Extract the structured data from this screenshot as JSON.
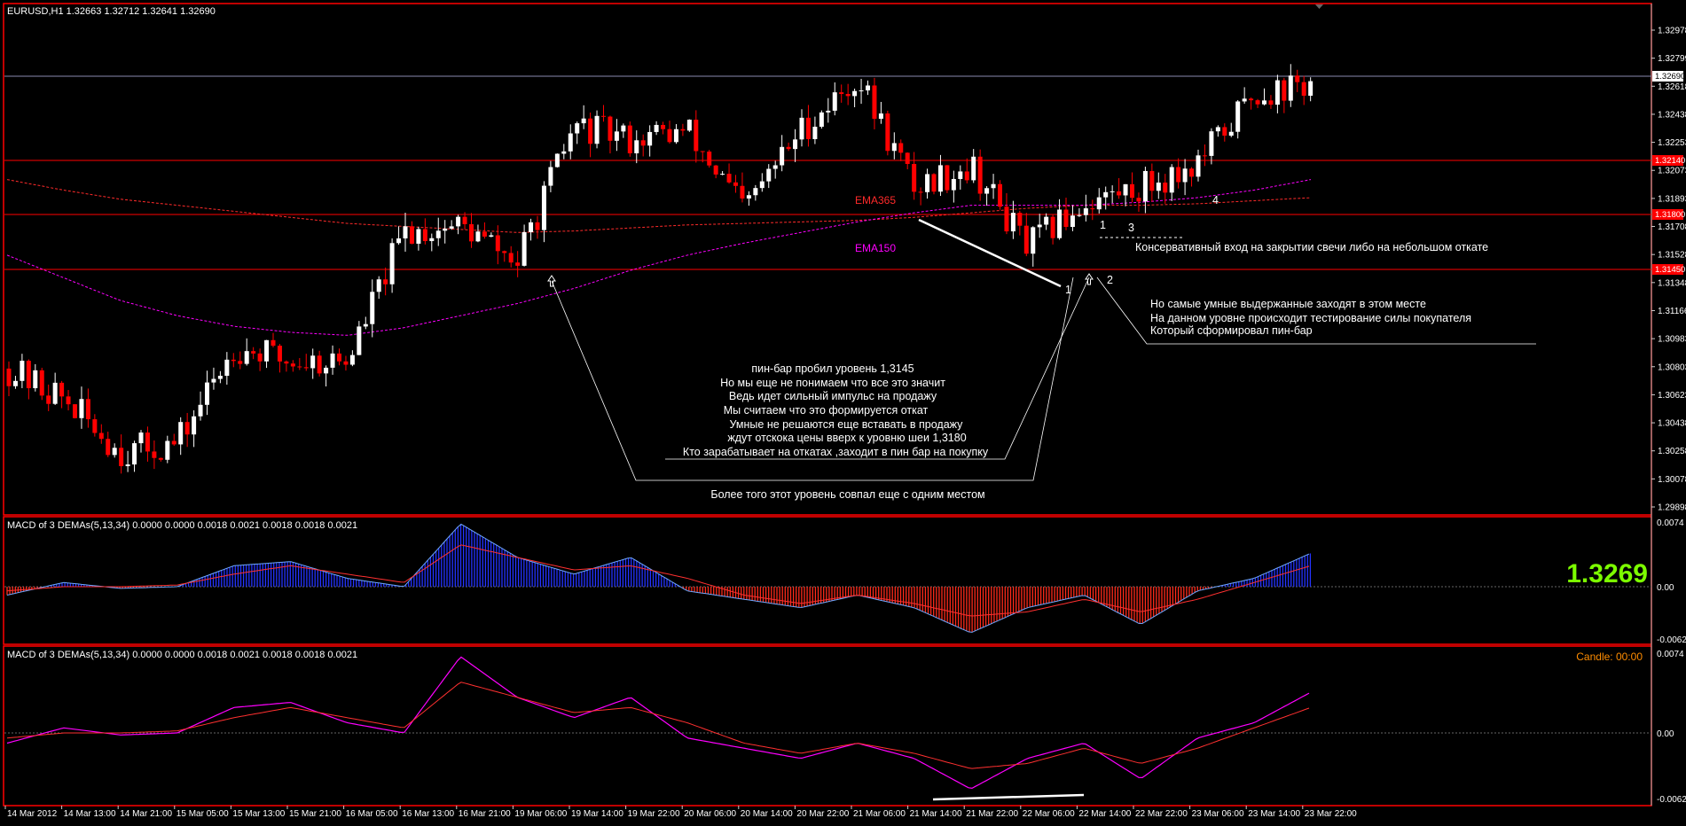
{
  "header": {
    "symbol_title": "EURUSD,H1  1.32663 1.32712 1.32641 1.32690"
  },
  "colors": {
    "background": "#000000",
    "frame": "#ff0000",
    "candle_up": "#ffffff",
    "candle_down": "#ff0000",
    "level_line": "#ff0000",
    "bid_line": "#8a8ab0",
    "ema365": "#ff2a2a",
    "ema150": "#ff00ff",
    "hist_positive": "#2433ff",
    "hist_negative": "#ff2a1a",
    "macd_line_top": "#6fa8ff",
    "signal_line": "#ff3030",
    "macd_line_bottom": "#ff00ff",
    "big_price": "#7cfc00",
    "candle_timer": "#ff8c00"
  },
  "main": {
    "price_axis_ticks": [
      "1.32978",
      "1.32799",
      "1.32618",
      "1.32438",
      "1.32253",
      "1.32073",
      "1.31893",
      "1.31708",
      "1.31528",
      "1.31348",
      "1.31166",
      "1.30983",
      "1.30803",
      "1.30623",
      "1.30438",
      "1.30258",
      "1.30078",
      "1.29898"
    ],
    "highlighted_prices": [
      "1.32690",
      "1.32140",
      "1.31800",
      "1.31450"
    ],
    "time_labels": [
      "14 Mar 2012",
      "14 Mar 13:00",
      "14 Mar 21:00",
      "15 Mar 05:00",
      "15 Mar 13:00",
      "15 Mar 21:00",
      "16 Mar 05:00",
      "16 Mar 13:00",
      "16 Mar 21:00",
      "19 Mar 06:00",
      "19 Mar 14:00",
      "19 Mar 22:00",
      "20 Mar 06:00",
      "20 Mar 14:00",
      "20 Mar 22:00",
      "21 Mar 06:00",
      "21 Mar 14:00",
      "21 Mar 22:00",
      "22 Mar 06:00",
      "22 Mar 14:00",
      "22 Mar 22:00",
      "23 Mar 06:00",
      "23 Mar 14:00",
      "23 Mar 22:00"
    ],
    "ema365_label": "EMA365",
    "ema150_label": "EMA150",
    "point_labels": [
      "1",
      "2",
      "3",
      "4",
      "1"
    ],
    "annotation_conservative": "Консервативный вход на закрытии свечи либо на небольшом откате",
    "annotation_right": [
      "Но самые умные выдержанные заходят в этом месте",
      "На данном уровне происходит тестирование силы покупателя",
      "Который сформировал пин-бар"
    ],
    "annotation_center": [
      "пин-бар пробил уровень 1,3145",
      "Но мы еще не понимаем что все это значит",
      "Ведь идет сильный импульс на продажу",
      "Мы считаем что это формируется откат",
      "Умные не решаются еще вставать в продажу",
      "ждут отскока цены вверх к уровню шеи 1,3180",
      "Кто зарабатывает на откатах ,заходит в пин бар на покупку"
    ],
    "annotation_bottom": "Более того этот уровень совпал еще с одним местом"
  },
  "macd_top": {
    "title": "MACD of 3 DEMAs(5,13,34) 0.0000 0.0000 0.0018 0.0021 0.0018 0.0018 0.0021",
    "axis_ticks": [
      "0.0074",
      "0.00",
      "-0.0062"
    ],
    "big_price": "1.3269"
  },
  "macd_bottom": {
    "title": "MACD of 3 DEMAs(5,13,34) 0.0000 0.0000 0.0018 0.0021 0.0018 0.0018 0.0021",
    "axis_ticks": [
      "0.0074",
      "0.00",
      "-0.0062"
    ],
    "candle_timer": "Candle:  00:00"
  },
  "chart_data": [
    {
      "type": "candlestick",
      "title": "EURUSD,H1",
      "timeframe": "H1",
      "ylim": [
        1.2985,
        1.3312
      ],
      "levels": [
        1.3269,
        1.3214,
        1.318,
        1.3145
      ],
      "anchors_x": [
        "14 Mar 2012",
        "14 Mar 13:00",
        "14 Mar 21:00",
        "15 Mar 05:00",
        "15 Mar 13:00",
        "15 Mar 21:00",
        "16 Mar 05:00",
        "16 Mar 13:00",
        "16 Mar 21:00",
        "19 Mar 06:00",
        "19 Mar 14:00",
        "19 Mar 22:00",
        "20 Mar 06:00",
        "20 Mar 14:00",
        "20 Mar 22:00",
        "21 Mar 06:00",
        "21 Mar 14:00",
        "21 Mar 22:00",
        "22 Mar 06:00",
        "22 Mar 14:00",
        "22 Mar 22:00",
        "23 Mar 06:00",
        "23 Mar 14:00",
        "23 Mar 22:00"
      ],
      "close_path_at_anchors": [
        1.308,
        1.306,
        1.3025,
        1.303,
        1.3095,
        1.3085,
        1.3085,
        1.317,
        1.3175,
        1.315,
        1.324,
        1.3232,
        1.3237,
        1.3185,
        1.3238,
        1.3272,
        1.32,
        1.3215,
        1.316,
        1.319,
        1.32,
        1.3215,
        1.3262,
        1.3268
      ],
      "ema365_at_anchors": [
        1.3205,
        1.3198,
        1.3192,
        1.3188,
        1.3184,
        1.318,
        1.3176,
        1.3174,
        1.3172,
        1.317,
        1.3171,
        1.3173,
        1.3175,
        1.3176,
        1.3177,
        1.3178,
        1.318,
        1.3183,
        1.3186,
        1.3188,
        1.3188,
        1.3189,
        1.3191,
        1.3193
      ],
      "ema150_at_anchors": [
        1.3155,
        1.314,
        1.3125,
        1.3115,
        1.3108,
        1.3104,
        1.3102,
        1.3107,
        1.3115,
        1.3123,
        1.3133,
        1.3145,
        1.3155,
        1.3163,
        1.317,
        1.3177,
        1.3183,
        1.3188,
        1.3188,
        1.3188,
        1.319,
        1.3193,
        1.3198,
        1.3205
      ]
    },
    {
      "type": "bar",
      "title": "MACD of 3 DEMAs(5,13,34)",
      "ylim": [
        -0.0062,
        0.0074
      ],
      "anchors_x": [
        "14 Mar 2012",
        "14 Mar 13:00",
        "14 Mar 21:00",
        "15 Mar 05:00",
        "15 Mar 13:00",
        "15 Mar 21:00",
        "16 Mar 05:00",
        "16 Mar 13:00",
        "16 Mar 21:00",
        "19 Mar 06:00",
        "19 Mar 14:00",
        "19 Mar 22:00",
        "20 Mar 06:00",
        "20 Mar 14:00",
        "20 Mar 22:00",
        "21 Mar 06:00",
        "21 Mar 14:00",
        "21 Mar 22:00",
        "22 Mar 06:00",
        "22 Mar 14:00",
        "22 Mar 22:00",
        "23 Mar 06:00",
        "23 Mar 14:00",
        "23 Mar 22:00"
      ],
      "series": [
        {
          "name": "MACD",
          "values": [
            -0.001,
            0.0005,
            -0.0002,
            0.0,
            0.0025,
            0.003,
            0.001,
            0.0,
            0.0075,
            0.0035,
            0.0015,
            0.0035,
            -0.0005,
            -0.0015,
            -0.0025,
            -0.001,
            -0.0025,
            -0.0055,
            -0.0025,
            -0.001,
            -0.0045,
            -0.0005,
            0.001,
            0.004
          ]
        },
        {
          "name": "Signal",
          "values": [
            -0.0005,
            0.0,
            0.0,
            0.0002,
            0.0015,
            0.0025,
            0.0015,
            0.0005,
            0.005,
            0.0035,
            0.002,
            0.0025,
            0.001,
            -0.001,
            -0.002,
            -0.001,
            -0.002,
            -0.0035,
            -0.003,
            -0.0015,
            -0.003,
            -0.0015,
            0.0005,
            0.0025
          ]
        }
      ]
    },
    {
      "type": "line",
      "title": "MACD of 3 DEMAs(5,13,34)",
      "ylim": [
        -0.0062,
        0.0074
      ],
      "anchors_x": [
        "14 Mar 2012",
        "14 Mar 13:00",
        "14 Mar 21:00",
        "15 Mar 05:00",
        "15 Mar 13:00",
        "15 Mar 21:00",
        "16 Mar 05:00",
        "16 Mar 13:00",
        "16 Mar 21:00",
        "19 Mar 06:00",
        "19 Mar 14:00",
        "19 Mar 22:00",
        "20 Mar 06:00",
        "20 Mar 14:00",
        "20 Mar 22:00",
        "21 Mar 06:00",
        "21 Mar 14:00",
        "21 Mar 22:00",
        "22 Mar 06:00",
        "22 Mar 14:00",
        "22 Mar 22:00",
        "23 Mar 06:00",
        "23 Mar 14:00",
        "23 Mar 22:00"
      ],
      "series": [
        {
          "name": "MACD",
          "values": [
            -0.001,
            0.0005,
            -0.0002,
            0.0,
            0.0025,
            0.003,
            0.001,
            0.0,
            0.0075,
            0.0035,
            0.0015,
            0.0035,
            -0.0005,
            -0.0015,
            -0.0025,
            -0.001,
            -0.0025,
            -0.0055,
            -0.0025,
            -0.001,
            -0.0045,
            -0.0005,
            0.001,
            0.004
          ]
        },
        {
          "name": "Signal",
          "values": [
            -0.0005,
            0.0,
            0.0,
            0.0002,
            0.0015,
            0.0025,
            0.0015,
            0.0005,
            0.005,
            0.0035,
            0.002,
            0.0025,
            0.001,
            -0.001,
            -0.002,
            -0.001,
            -0.002,
            -0.0035,
            -0.003,
            -0.0015,
            -0.003,
            -0.0015,
            0.0005,
            0.0025
          ]
        }
      ]
    }
  ]
}
